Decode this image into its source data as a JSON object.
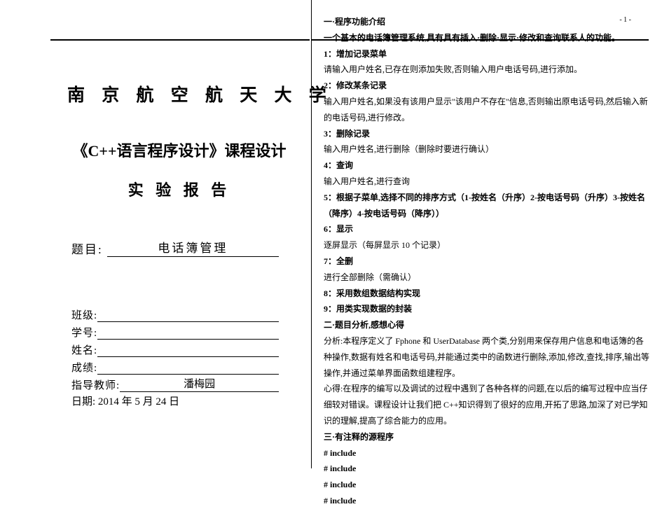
{
  "cover": {
    "university": "南 京 航 空 航 天 大 学",
    "course": "《C++语言程序设计》课程设计",
    "report": "实 验 报 告",
    "title_label": "题目:",
    "title_value": "电话簿管理",
    "fields": {
      "class_label": "班级:",
      "class_value": "",
      "id_label": "学号:",
      "id_value": "",
      "name_label": "姓名:",
      "name_value": "",
      "grade_label": "成绩:",
      "grade_value": "",
      "advisor_label": "指导教师:",
      "advisor_value": "潘梅园"
    },
    "date": "日期: 2014   年  5 月   24   日"
  },
  "right": {
    "indicator": "- 1 -",
    "s1": "一·程序功能介绍",
    "desc": "一个基本的电话簿管理系统,具有具有插入·删除·显示·修改和查询联系人的功能。",
    "f1": "1：增加记录菜单",
    "f1_body": "请输入用户姓名,已存在则添加失败,否则输入用户电话号码,进行添加。",
    "f2": "2：修改某条记录",
    "f2_body": "输入用户姓名,如果没有该用户显示\"该用户不存在\"信息,否则输出原电话号码,然后输入新的电话号码,进行修改。",
    "f3": "3：删除记录",
    "f3_body": "输入用户姓名,进行删除（删除时要进行确认）",
    "f4": "4：查询",
    "f4_body": "输入用户姓名,进行查询",
    "f5": "5：根据子菜单,选择不同的排序方式（1-按姓名（升序）2-按电话号码（升序）3-按姓名（降序）4-按电话号码（降序））",
    "f6": "6：显示",
    "f6_body": "逐屏显示（每屏显示 10 个记录）",
    "f7": "7：全删",
    "f7_body": "进行全部删除（需确认）",
    "f8": "8：采用数组数据结构实现",
    "f9": "9：用类实现数据的封装",
    "s2": "二·题目分析,感想心得",
    "analysis": "分析:本程序定义了 Fphone 和 UserDatabase 两个类,分别用来保存用户信息和电话簿的各种操作,数据有姓名和电话号码,并能通过类中的函数进行删除,添加,修改,查找,排序,输出等操作,并通过菜单界面函数组建程序。",
    "feel": "心得:在程序的编写以及调试的过程中遇到了各种各样的问题,在以后的编写过程中应当仔细较对错误。课程设计让我们把 C++知识得到了很好的应用,开拓了思路,加深了对已学知识的理解,提高了综合能力的应用。",
    "s3": "三·有注释的源程序",
    "inc1": "# include",
    "inc2": "# include",
    "inc3": "# include",
    "inc4": "# include"
  }
}
